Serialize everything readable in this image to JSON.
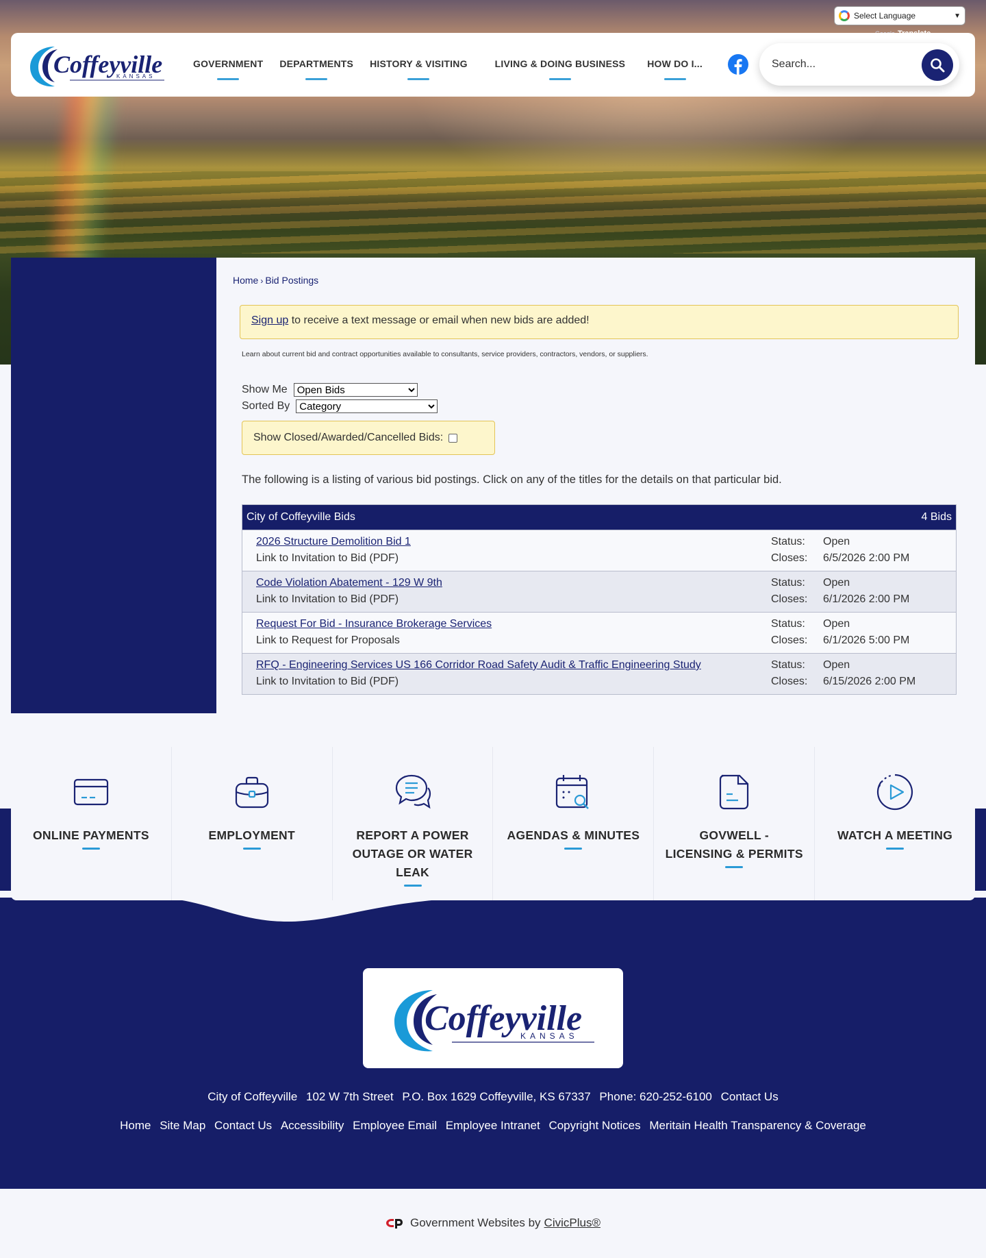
{
  "translate": {
    "label": "Select Language",
    "powered_by": "Google",
    "powered_text": "Translate"
  },
  "header": {
    "logo_alt": "Coffeyville",
    "logo_state": "KANSAS",
    "nav": [
      "GOVERNMENT",
      "DEPARTMENTS",
      "HISTORY & VISITING",
      "LIVING & DOING BUSINESS",
      "HOW DO I..."
    ],
    "search_placeholder": "Search..."
  },
  "breadcrumb": {
    "home": "Home",
    "separator": "›",
    "current": "Bid Postings"
  },
  "alert": {
    "link": "Sign up",
    "text": " to receive a text message or email when new bids are added!"
  },
  "intro": "Learn about current bid and contract opportunities available to consultants, service providers, contractors, vendors, or suppliers.",
  "filters": {
    "show_me_label": "Show Me",
    "show_me_value": "Open Bids",
    "sorted_by_label": "Sorted By",
    "sorted_by_value": "Category",
    "closed_label": "Show Closed/Awarded/Cancelled Bids:"
  },
  "listing_note": "The following is a listing of various bid postings. Click on any of the titles for the details on that particular bid.",
  "bids": {
    "group": "City of Coffeyville Bids",
    "count": "4 Bids",
    "status_label": "Status:",
    "closes_label": "Closes:",
    "items": [
      {
        "title": "2026 Structure Demolition Bid 1",
        "sub": "Link to Invitation to Bid (PDF)",
        "status": "Open",
        "closes": "6/5/2026 2:00 PM"
      },
      {
        "title": "Code Violation Abatement - 129 W 9th",
        "sub": "Link to Invitation to Bid (PDF)",
        "status": "Open",
        "closes": "6/1/2026 2:00 PM"
      },
      {
        "title": "Request For Bid - Insurance Brokerage Services",
        "sub": "Link to Request for Proposals",
        "status": "Open",
        "closes": "6/1/2026 5:00 PM"
      },
      {
        "title": "RFQ - Engineering Services US 166 Corridor Road Safety Audit & Traffic Engineering Study",
        "sub": "Link to Invitation to Bid (PDF)",
        "status": "Open",
        "closes": "6/15/2026 2:00 PM"
      }
    ]
  },
  "quick_links": [
    {
      "label": "ONLINE PAYMENTS",
      "icon": "card-icon"
    },
    {
      "label": "EMPLOYMENT",
      "icon": "briefcase-icon"
    },
    {
      "label": "REPORT A POWER OUTAGE OR WATER LEAK",
      "icon": "chat-bubbles-icon"
    },
    {
      "label": "AGENDAS & MINUTES",
      "icon": "calendar-search-icon"
    },
    {
      "label": "GOVWELL - LICENSING & PERMITS",
      "icon": "document-icon"
    },
    {
      "label": "WATCH A MEETING",
      "icon": "play-circle-icon"
    }
  ],
  "footer": {
    "address": [
      "City of Coffeyville",
      "102 W 7th Street",
      "P.O. Box 1629 Coffeyville, KS 67337",
      "Phone: 620-252-6100",
      "Contact Us"
    ],
    "links": [
      "Home",
      "Site Map",
      "Contact Us",
      "Accessibility",
      "Employee Email",
      "Employee Intranet",
      "Copyright Notices",
      "Meritain Health Transparency & Coverage"
    ],
    "credit_text": "Government Websites by",
    "credit_link": "CivicPlus®"
  },
  "colors": {
    "navy": "#161e68",
    "accent": "#2a9ad6",
    "alert_bg": "#fdf6cc",
    "facebook": "#1877f2"
  }
}
